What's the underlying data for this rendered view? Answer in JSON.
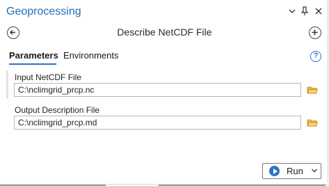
{
  "window": {
    "title": "Geoprocessing"
  },
  "titlebar_icons": [
    {
      "name": "menu-chevron-icon",
      "glyph": "⌄"
    },
    {
      "name": "pin-icon",
      "glyph": "📌"
    },
    {
      "name": "close-icon",
      "glyph": "✕"
    }
  ],
  "tool": {
    "title": "Describe NetCDF File"
  },
  "tabs": [
    {
      "label": "Parameters",
      "active": true
    },
    {
      "label": "Environments",
      "active": false
    }
  ],
  "help": {
    "glyph": "?"
  },
  "params": [
    {
      "label": "Input NetCDF File",
      "value": "C:\\nclimgrid_prcp.nc"
    },
    {
      "label": "Output Description File",
      "value": "C:\\nclimgrid_prcp.md"
    }
  ],
  "run": {
    "label": "Run",
    "caret": "⌄"
  },
  "colors": {
    "accent": "#2b74c7",
    "title": "#1f6fb6",
    "folder": "#e8b84a"
  }
}
